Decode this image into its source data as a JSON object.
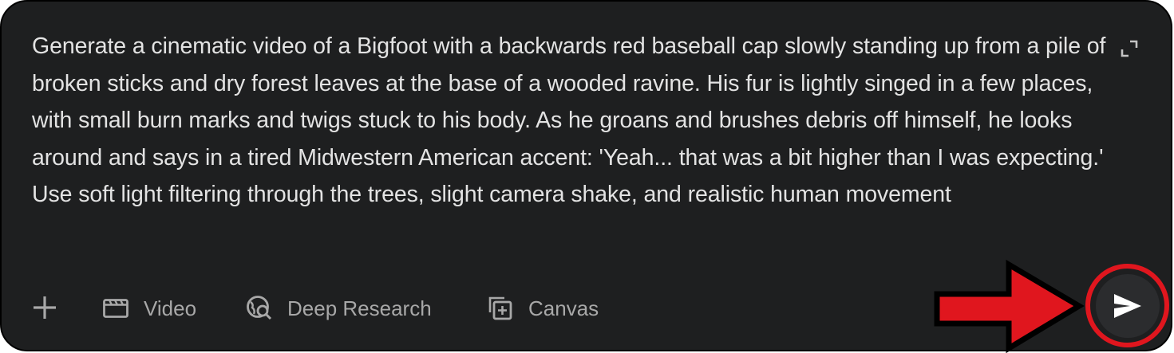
{
  "composer": {
    "prompt_text": "Generate a cinematic video of a Bigfoot with a backwards red baseball cap slowly standing up from a pile of broken sticks and dry forest leaves at the base of a wooded ravine. His fur is lightly singed in a few places, with small burn marks and twigs stuck to his body. As he groans and brushes debris off himself, he looks around and says in a tired Midwestern American accent: 'Yeah... that was a bit higher than I was expecting.' Use soft light filtering through the trees, slight camera shake, and realistic human movement",
    "expand_icon": "expand-icon",
    "background_color": "#1e1f20",
    "text_color": "#e3e3e3"
  },
  "toolbar": {
    "add_icon": "plus-icon",
    "tools": [
      {
        "label": "Video",
        "icon": "video-icon"
      },
      {
        "label": "Deep Research",
        "icon": "deep-research-icon"
      },
      {
        "label": "Canvas",
        "icon": "canvas-icon"
      }
    ],
    "send_icon": "send-icon"
  },
  "annotation": {
    "arrow_color": "#e0161e",
    "circle_color": "#e0161e"
  }
}
